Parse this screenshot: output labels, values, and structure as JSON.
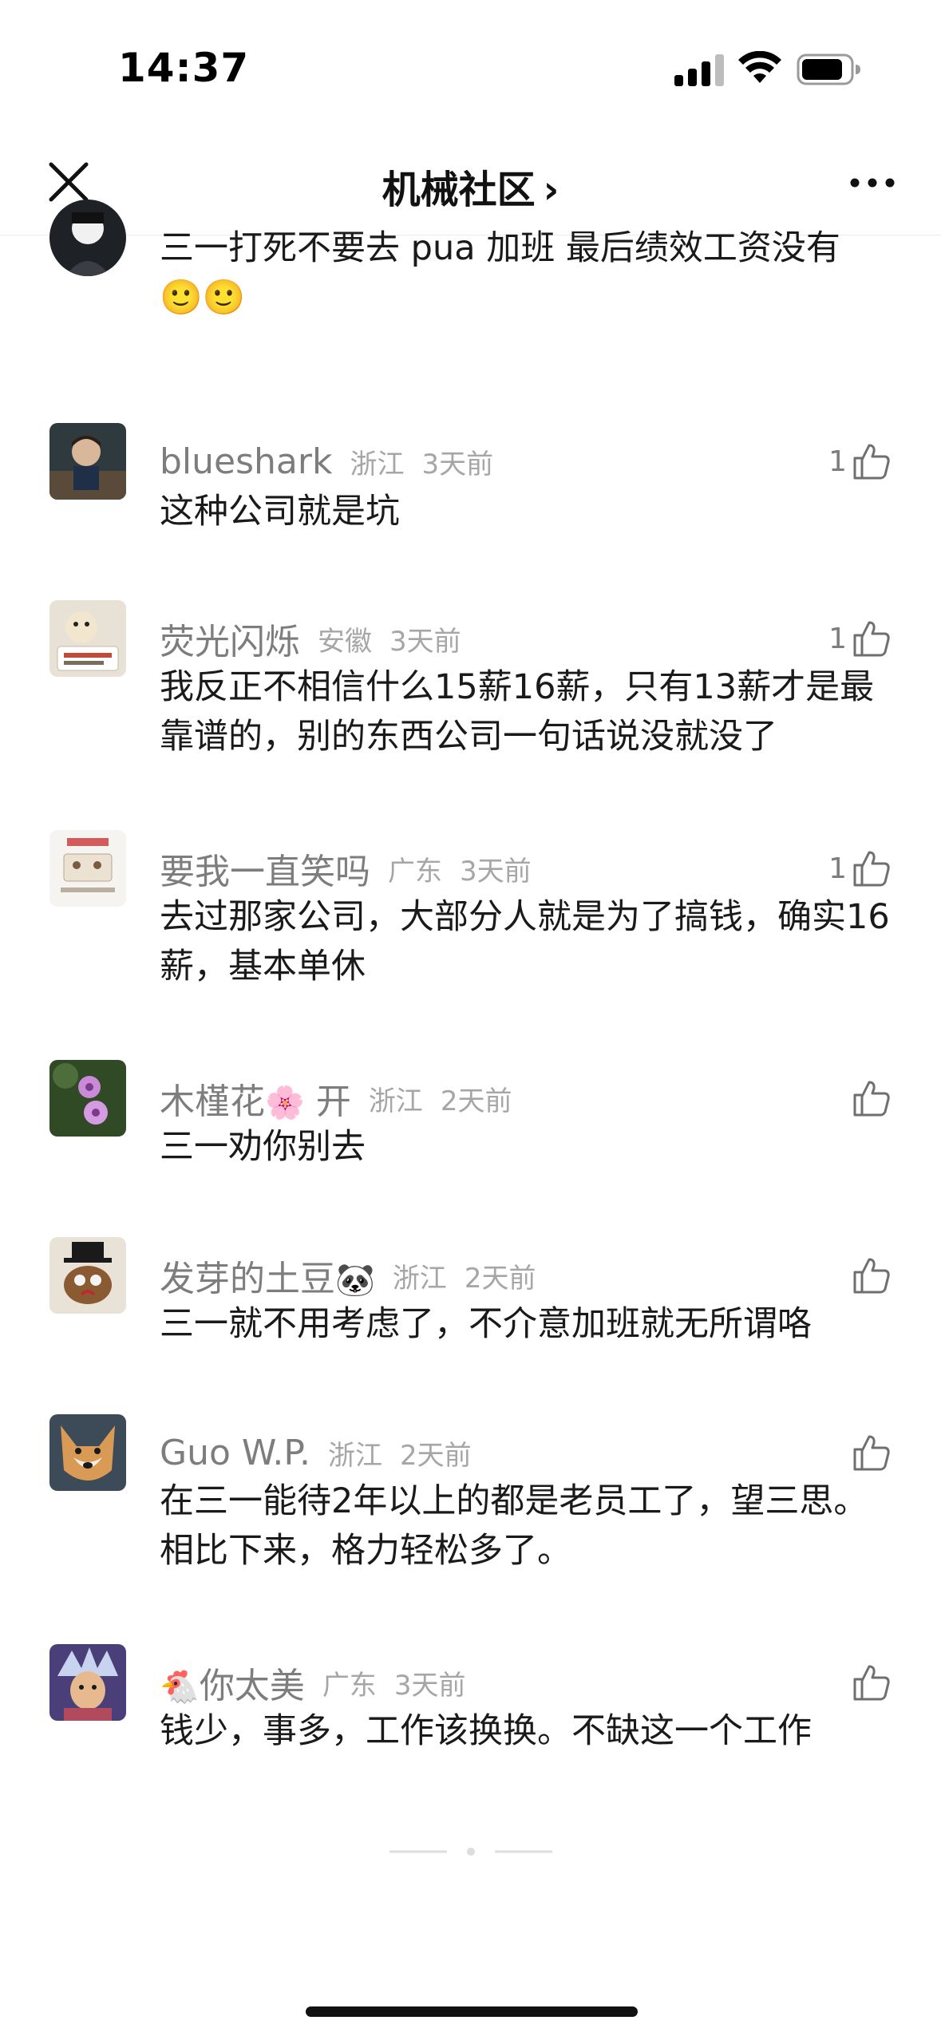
{
  "status_bar": {
    "time": "14:37",
    "signal_icon": "cellular-signal-icon",
    "wifi_icon": "wifi-icon",
    "battery_icon": "battery-icon"
  },
  "nav": {
    "title": "机械社区",
    "chevron": "›",
    "close_icon": "close-icon",
    "more_icon": "more-dots-icon"
  },
  "top_partial_comment": {
    "text": "三一打死不要去 pua 加班 最后绩效工资没有",
    "emojis": "🙂🙂"
  },
  "comments": [
    {
      "username": "blueshark",
      "location": "浙江",
      "time_ago": "3天前",
      "likes": "1",
      "text": "这种公司就是坑"
    },
    {
      "username": "荧光闪烁",
      "location": "安徽",
      "time_ago": "3天前",
      "likes": "1",
      "text": "我反正不相信什么15薪16薪，只有13薪才是最靠谱的，别的东西公司一句话说没就没了"
    },
    {
      "username": "要我一直笑吗",
      "location": "广东",
      "time_ago": "3天前",
      "likes": "1",
      "text": "去过那家公司，大部分人就是为了搞钱，确实16薪，基本单休"
    },
    {
      "username_prefix": "木槿花",
      "username_emoji": "🌸",
      "username_suffix": "开",
      "location": "浙江",
      "time_ago": "2天前",
      "likes": "",
      "text": "三一劝你别去"
    },
    {
      "username_prefix": "发芽的土豆",
      "username_emoji": "🐼",
      "username_suffix": "",
      "location": "浙江",
      "time_ago": "2天前",
      "likes": "",
      "text": "三一就不用考虑了，不介意加班就无所谓咯"
    },
    {
      "username": "Guo W.P.",
      "location": "浙江",
      "time_ago": "2天前",
      "likes": "",
      "text": "在三一能待2年以上的都是老员工了，望三思。相比下来，格力轻松多了。"
    },
    {
      "username_prefix": "",
      "username_emoji": "🐔",
      "username_suffix": "你太美",
      "location": "广东",
      "time_ago": "3天前",
      "likes": "",
      "text": "钱少，事多，工作该换换。不缺这一个工作"
    }
  ],
  "icons": {
    "like": "thumbs-up-icon"
  },
  "colors": {
    "username": "#7d7d7d",
    "meta": "#a6a6a6",
    "text": "#1a1a1a"
  }
}
